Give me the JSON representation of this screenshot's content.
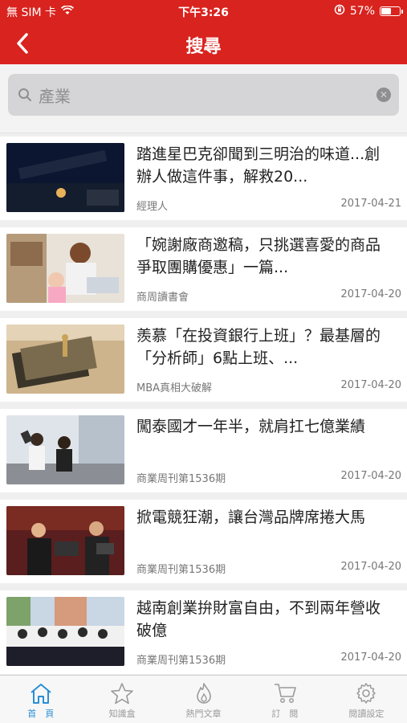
{
  "status": {
    "carrier": "無 SIM 卡",
    "time": "下午3:26",
    "battery_text": "57%",
    "battery_level": 0.57
  },
  "nav": {
    "title": "搜尋"
  },
  "search": {
    "query": "產業"
  },
  "articles": [
    {
      "title": "踏進星巴克卻聞到三明治的味道...創辦人做這件事，解救20...",
      "source": "經理人",
      "date": "2017-04-21"
    },
    {
      "title": "「婉謝廠商邀稿，只挑選喜愛的商品爭取團購優惠」一篇...",
      "source": "商周讀書會",
      "date": "2017-04-20"
    },
    {
      "title": "羨慕「在投資銀行上班」？最基層的「分析師」6點上班、...",
      "source": "MBA真相大破解",
      "date": "2017-04-20"
    },
    {
      "title": "闖泰國才一年半，就肩扛七億業績",
      "source": "商業周刊第1536期",
      "date": "2017-04-20"
    },
    {
      "title": "掀電競狂潮，讓台灣品牌席捲大馬",
      "source": "商業周刊第1536期",
      "date": "2017-04-20"
    },
    {
      "title": "越南創業拚財富自由，不到兩年營收破億",
      "source": "商業周刊第1536期",
      "date": "2017-04-20"
    }
  ],
  "tabs": [
    {
      "label": "首　頁",
      "icon": "home-icon",
      "active": true
    },
    {
      "label": "知識盒",
      "icon": "star-icon",
      "active": false
    },
    {
      "label": "熱門文章",
      "icon": "flame-icon",
      "active": false
    },
    {
      "label": "訂　閱",
      "icon": "cart-icon",
      "active": false
    },
    {
      "label": "閱讀設定",
      "icon": "gear-icon",
      "active": false
    }
  ],
  "colors": {
    "brand": "#d9231e",
    "tab_active": "#2a8fd6",
    "tab_inactive": "#9a9a9a"
  }
}
